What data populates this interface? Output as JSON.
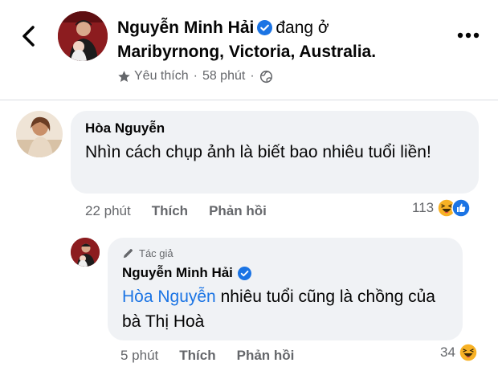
{
  "post_header": {
    "author_name": "Nguyễn Minh Hải",
    "status_text": "đang ở",
    "location": "Maribyrnong, Victoria, Australia.",
    "favorite_label": "Yêu thích",
    "separator": "·",
    "time": "58 phút",
    "icons": [
      "back-arrow-icon",
      "verified-icon",
      "star-icon",
      "globe-icon",
      "more-icon"
    ]
  },
  "comments": [
    {
      "author": "Hòa Nguyễn",
      "text": "Nhìn cách chụp ảnh là biết bao nhiêu tuổi liền!",
      "time": "22 phút",
      "like_label": "Thích",
      "reply_label": "Phản hồi",
      "reaction_count": "113",
      "reactions": [
        "haha-emoji",
        "like-emoji"
      ]
    }
  ],
  "reply": {
    "badge_label": "Tác giả",
    "author": "Nguyễn Minh Hải",
    "mention": "Hòa Nguyễn",
    "text": " nhiêu tuổi cũng là chồng của bà Thị Hoà",
    "time": "5 phút",
    "like_label": "Thích",
    "reply_label": "Phản hồi",
    "reaction_count": "34",
    "reactions": [
      "haha-emoji"
    ]
  },
  "colors": {
    "bubble_bg": "#f0f2f5",
    "secondary_text": "#65676b",
    "verified_blue": "#1b74e4",
    "mention_blue": "#1b74e4",
    "haha_yellow": "#f7b125"
  }
}
